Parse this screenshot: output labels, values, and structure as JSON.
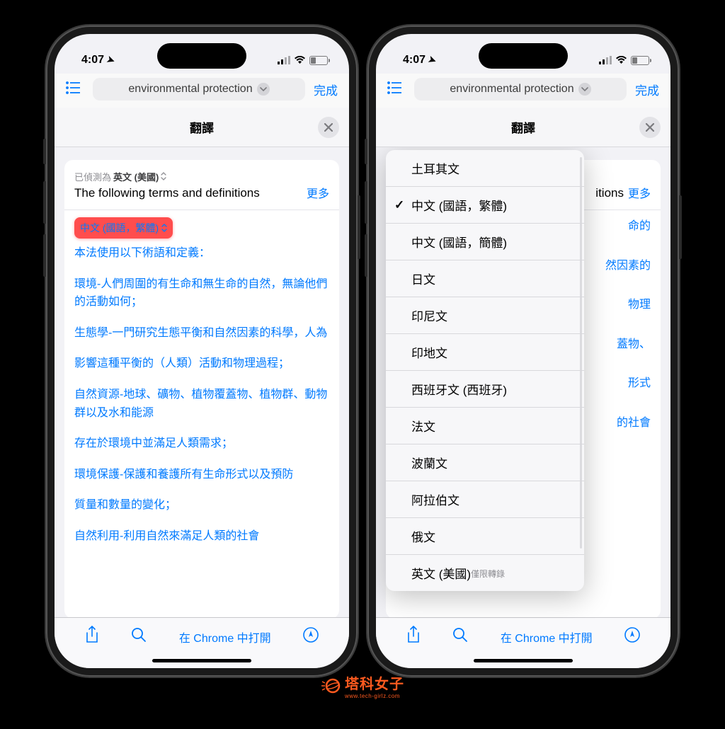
{
  "status": {
    "time": "4:07",
    "location_on": true
  },
  "url_bar": {
    "title": "environmental protection",
    "done": "完成"
  },
  "sheet": {
    "title": "翻譯"
  },
  "source": {
    "detected_prefix": "已偵測為",
    "detected_lang": "英文 (美國)",
    "text": "The following terms and definitions",
    "more": "更多"
  },
  "target": {
    "lang": "中文 (國語，繁體)",
    "paragraphs": [
      "本法使用以下術語和定義：",
      "環境-人們周圍的有生命和無生命的自然，無論他們的活動如何；",
      "生態學-一門研究生態平衡和自然因素的科學，人為",
      "影響這種平衡的（人類）活動和物理過程；",
      "自然資源-地球、礦物、植物覆蓋物、植物群、動物群以及水和能源",
      "存在於環境中並滿足人類需求；",
      "環境保護-保護和養護所有生命形式以及預防",
      "質量和數量的變化；",
      "自然利用-利用自然來滿足人類的社會"
    ]
  },
  "source_right": {
    "detected_preview": "已偵測為 英文 (美國)",
    "text_suffix": "itions",
    "more": "更多"
  },
  "bg_fragments": [
    "命的",
    "然因素的",
    "物理",
    "蓋物、",
    "形式",
    "的社會"
  ],
  "toolbar": {
    "open_chrome": "在 Chrome 中打開"
  },
  "lang_menu": [
    {
      "label": "土耳其文",
      "checked": false
    },
    {
      "label": "中文 (國語，繁體)",
      "checked": true
    },
    {
      "label": "中文 (國語，簡體)",
      "checked": false
    },
    {
      "label": "日文",
      "checked": false
    },
    {
      "label": "印尼文",
      "checked": false
    },
    {
      "label": "印地文",
      "checked": false
    },
    {
      "label": "西班牙文 (西班牙)",
      "checked": false
    },
    {
      "label": "法文",
      "checked": false
    },
    {
      "label": "波蘭文",
      "checked": false
    },
    {
      "label": "阿拉伯文",
      "checked": false
    },
    {
      "label": "俄文",
      "checked": false
    },
    {
      "label": "英文 (美國)",
      "checked": false,
      "sub": "僅限轉錄"
    }
  ],
  "watermark": {
    "name": "塔科女子",
    "url": "www.tech-girlz.com"
  }
}
